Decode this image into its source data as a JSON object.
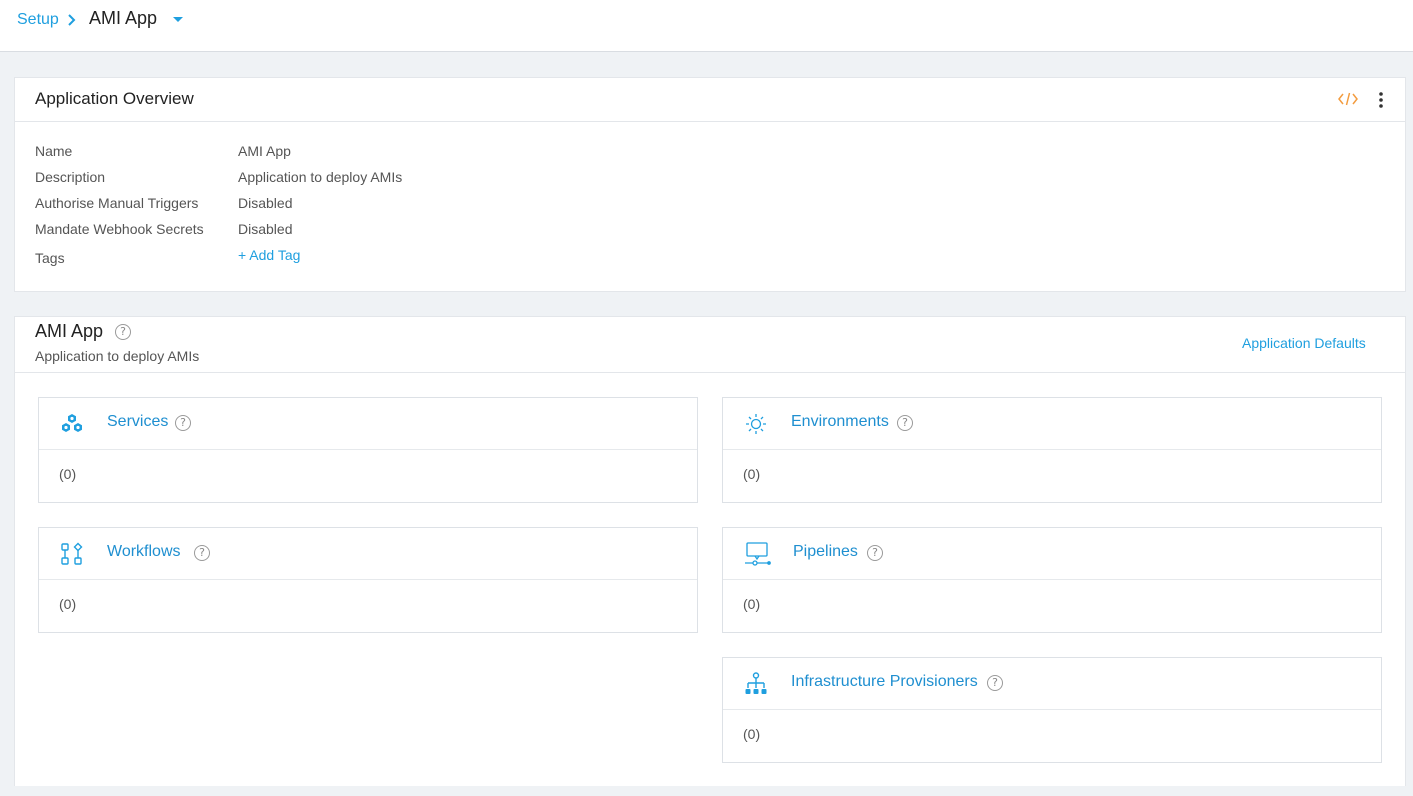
{
  "breadcrumb": {
    "root_label": "Setup",
    "current_label": "AMI App"
  },
  "overview": {
    "title": "Application Overview",
    "fields": [
      {
        "label": "Name",
        "value": "AMI App"
      },
      {
        "label": "Description",
        "value": "Application to deploy AMIs"
      },
      {
        "label": "Authorise Manual Triggers",
        "value": "Disabled"
      },
      {
        "label": "Mandate Webhook Secrets",
        "value": "Disabled"
      },
      {
        "label": "Tags",
        "value": "+ Add Tag"
      }
    ]
  },
  "app": {
    "title": "AMI App",
    "description": "Application to deploy AMIs",
    "defaults_link": "Application Defaults",
    "help_glyph": "?",
    "cards": [
      {
        "title": "Services",
        "count": "(0)",
        "icon": "services-icon"
      },
      {
        "title": "Environments",
        "count": "(0)",
        "icon": "environments-icon"
      },
      {
        "title": "Workflows",
        "count": "(0)",
        "icon": "workflows-icon"
      },
      {
        "title": "Pipelines",
        "count": "(0)",
        "icon": "pipelines-icon"
      },
      {
        "title": "Infrastructure Provisioners",
        "count": "(0)",
        "icon": "provisioners-icon"
      }
    ]
  },
  "colors": {
    "accent": "#1f9fdf",
    "code_icon": "#f39c3f",
    "background": "#eff2f5"
  }
}
